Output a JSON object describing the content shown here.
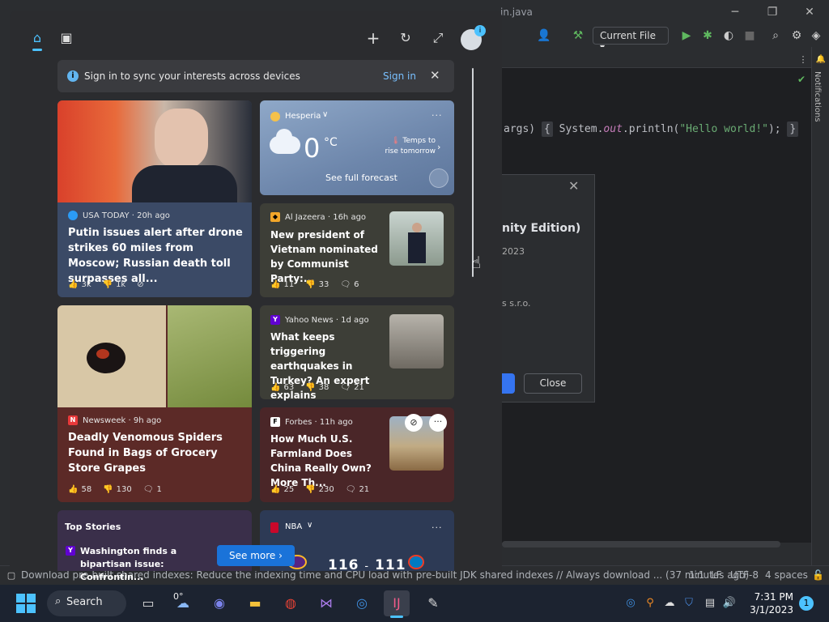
{
  "ide": {
    "title_file": "in.java",
    "current_file_label": "Current File",
    "code_args": "args) ",
    "code_brace_open": "{",
    "code_sys": " System.",
    "code_out": "out",
    "code_print": ".println(",
    "code_string": "\"Hello world!\"",
    "code_tail": ");",
    "code_brace_close": "}",
    "notifications_label": "Notifications",
    "about_title": "nity Edition)",
    "about_year": "2023",
    "about_company": "s s.r.o.",
    "about_close": "Close",
    "status_message": "Download pre-built shared indexes: Reduce the indexing time and CPU load with pre-built JDK shared indexes // Always download ... (37 minutes ago)",
    "status_position": "1:1",
    "status_line_sep": "LF",
    "status_encoding": "UTF-8",
    "status_indent": "4 spaces"
  },
  "widgets": {
    "signin_text": "Sign in to sync your interests across devices",
    "signin_link": "Sign in",
    "avatar_badge": "i",
    "weather": {
      "location": "Hesperia",
      "temp": "0",
      "unit": "°C",
      "note": "Temps to rise tomorrow",
      "forecast_link": "See full forecast"
    },
    "cards": [
      {
        "source": "USA TODAY · 20h ago",
        "headline": "Putin issues alert after drone strikes 60 miles from Moscow; Russian death toll surpasses all...",
        "likes": "3k",
        "dislikes": "1k"
      },
      {
        "source": "Al Jazeera · 16h ago",
        "headline": "New president of Vietnam nominated by Communist Party:...",
        "likes": "11",
        "dislikes": "33",
        "comments": "6"
      },
      {
        "source": "Yahoo News · 1d ago",
        "headline": "What keeps triggering earthquakes in Turkey? An expert explains",
        "likes": "63",
        "dislikes": "38",
        "comments": "21"
      },
      {
        "source": "Newsweek · 9h ago",
        "headline": "Deadly Venomous Spiders Found in Bags of Grocery Store Grapes",
        "likes": "58",
        "dislikes": "130",
        "comments": "1"
      },
      {
        "source": "Forbes · 11h ago",
        "headline": "How Much U.S. Farmland Does China Really Own? More Th...",
        "likes": "25",
        "dislikes": "230",
        "comments": "21"
      }
    ],
    "top_stories_label": "Top Stories",
    "top_story_headline": "Washington finds a bipartisan issue: Confrontin...",
    "nba_label": "NBA",
    "nba_score_home": "116",
    "nba_score_sep": "-",
    "nba_score_away": "111",
    "see_more": "See more"
  },
  "taskbar": {
    "search_label": "Search",
    "weather_temp": "0°",
    "time": "7:31 PM",
    "date": "3/1/2023",
    "notif_count": "1"
  },
  "colors": {
    "accent": "#4cc2ff",
    "see_more_bg": "#1a73d9",
    "ide_bg": "#2b2d30",
    "editor_bg": "#1e1f22"
  }
}
